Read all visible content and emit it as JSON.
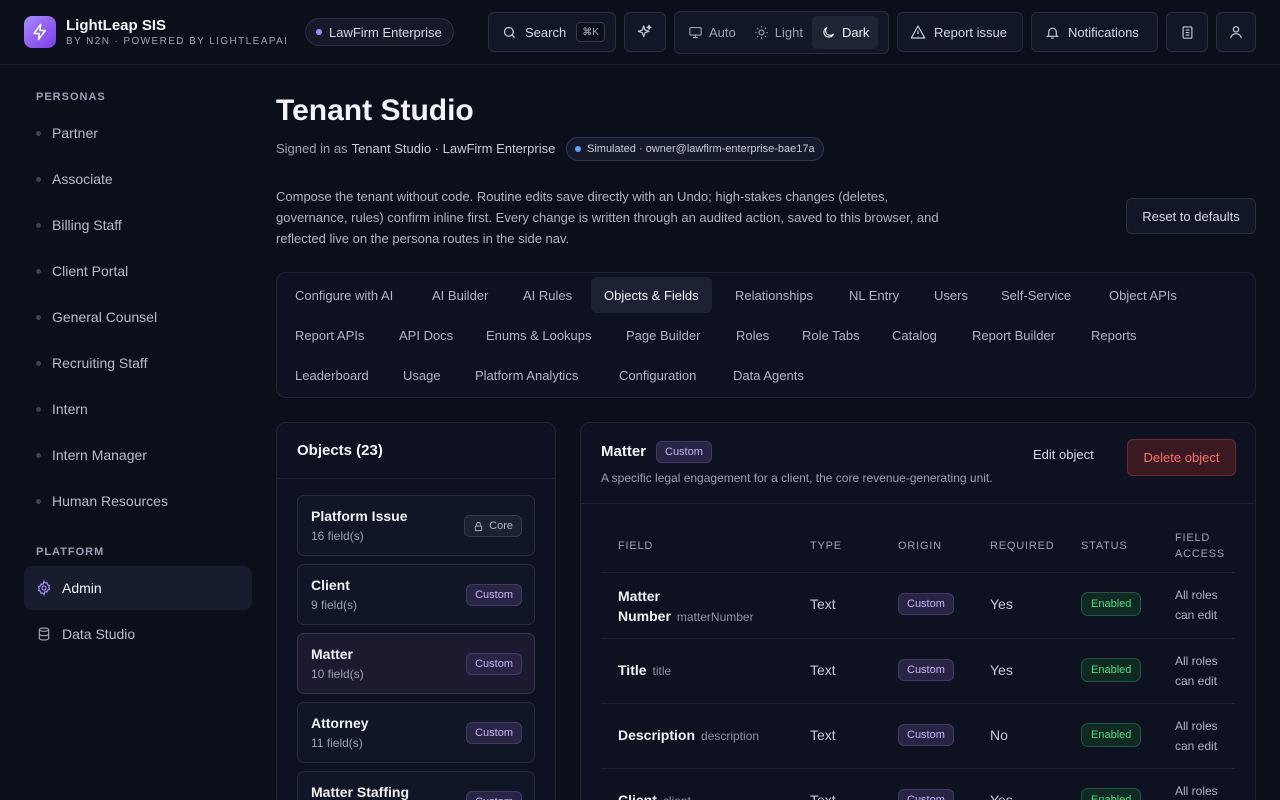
{
  "header": {
    "brand_name": "LightLeap SIS",
    "brand_sub": "BY N2N · POWERED BY LIGHTLEAPAI",
    "tenant": "LawFirm Enterprise",
    "search_label": "Search",
    "search_shortcut": "⌘K",
    "theme": {
      "auto": "Auto",
      "light": "Light",
      "dark": "Dark",
      "selected": "Dark"
    },
    "report_issue": "Report issue",
    "notifications": "Notifications"
  },
  "sidebar": {
    "personas_heading": "PERSONAS",
    "personas": [
      "Partner",
      "Associate",
      "Billing Staff",
      "Client Portal",
      "General Counsel",
      "Recruiting Staff",
      "Intern",
      "Intern Manager",
      "Human Resources"
    ],
    "platform_heading": "PLATFORM",
    "platform_items": [
      {
        "label": "Admin",
        "icon": "gear-icon",
        "active": true
      },
      {
        "label": "Data Studio",
        "icon": "database-icon",
        "active": false
      }
    ]
  },
  "main": {
    "title": "Tenant Studio",
    "signed_in_prefix": "Signed in as",
    "signed_in_as": "Tenant Studio · LawFirm Enterprise",
    "simulated": "Simulated · owner@lawfirm-enterprise-bae17a",
    "description": "Compose the tenant without code. Routine edits save directly with an Undo; high-stakes changes (deletes, governance, rules) confirm inline first. Every change is written through an audited action, saved to this browser, and reflected live on the persona routes in the side nav.",
    "reset_button": "Reset to defaults",
    "tabs": [
      [
        "Configure with AI",
        "AI Builder",
        "AI Rules",
        "Objects & Fields",
        "Relationships",
        "NL Entry",
        "Users",
        "Self-Service",
        "Object APIs"
      ],
      [
        "Report APIs",
        "API Docs",
        "Enums & Lookups",
        "Page Builder",
        "Roles",
        "Role Tabs",
        "Catalog",
        "Report Builder",
        "Reports"
      ],
      [
        "Leaderboard",
        "Usage",
        "Platform Analytics",
        "Configuration",
        "Data Agents"
      ]
    ],
    "active_tab": "Objects & Fields"
  },
  "objects": {
    "heading": "Objects (23)",
    "items": [
      {
        "name": "Platform Issue",
        "count": "16 field(s)",
        "badge": "Core"
      },
      {
        "name": "Client",
        "count": "9 field(s)",
        "badge": "Custom"
      },
      {
        "name": "Matter",
        "count": "10 field(s)",
        "badge": "Custom"
      },
      {
        "name": "Attorney",
        "count": "11 field(s)",
        "badge": "Custom"
      },
      {
        "name": "Matter Staffing",
        "count": "",
        "badge": "Custom"
      }
    ],
    "selected": "Matter"
  },
  "detail": {
    "name": "Matter",
    "badge": "Custom",
    "description": "A specific legal engagement for a client, the core revenue-generating unit.",
    "edit_button": "Edit object",
    "delete_button": "Delete object",
    "columns": {
      "field": "FIELD",
      "type": "TYPE",
      "origin": "ORIGIN",
      "required": "REQUIRED",
      "status": "STATUS",
      "access_1": "FIELD",
      "access_2": "ACCESS"
    },
    "rows": [
      {
        "name_1": "Matter",
        "name_2": "Number",
        "key": "matterNumber",
        "type": "Text",
        "origin": "Custom",
        "required": "Yes",
        "status": "Enabled",
        "access_1": "All roles",
        "access_2": "can edit"
      },
      {
        "name_1": "Title",
        "name_2": "",
        "key": "title",
        "type": "Text",
        "origin": "Custom",
        "required": "Yes",
        "status": "Enabled",
        "access_1": "All roles",
        "access_2": "can edit"
      },
      {
        "name_1": "Description",
        "name_2": "",
        "key": "description",
        "type": "Text",
        "origin": "Custom",
        "required": "No",
        "status": "Enabled",
        "access_1": "All roles",
        "access_2": "can edit"
      },
      {
        "name_1": "Client",
        "name_2": "",
        "key": "client",
        "type": "Text",
        "origin": "Custom",
        "required": "Yes",
        "status": "Enabled",
        "access_1": "All roles",
        "access_2": ""
      }
    ]
  },
  "colors": {
    "accent": "#a78bfa",
    "danger": "#f87171",
    "success": "#4ade80",
    "background": "#0b0f19"
  }
}
